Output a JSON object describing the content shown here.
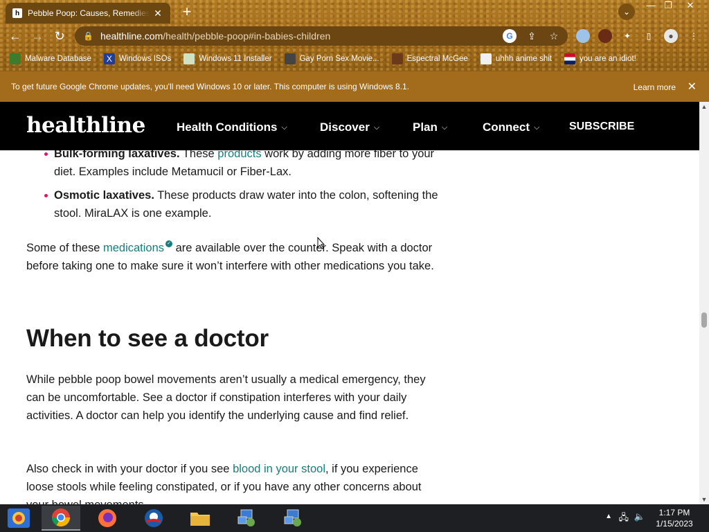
{
  "browser": {
    "tab_title": "Pebble Poop: Causes, Remedies, and More",
    "tab_favicon": "h",
    "url_host": "healthline.com",
    "url_path": "/health/pebble-poop#in-babies-children",
    "bookmarks": [
      {
        "label": "Malware Database",
        "icon": "globe-icon"
      },
      {
        "label": "Windows ISOs",
        "icon": "x-logo-icon"
      },
      {
        "label": "Windows 11 Installer",
        "icon": "image-icon"
      },
      {
        "label": "Gay Porn Sex Movie...",
        "icon": "avatar-icon"
      },
      {
        "label": "Espectral McGee",
        "icon": "avatar-icon"
      },
      {
        "label": "uhhh anime shit",
        "icon": "avatar-icon"
      },
      {
        "label": "you are an idiot!",
        "icon": "flag-icon"
      }
    ]
  },
  "infobar": {
    "message": "To get future Google Chrome updates, you'll need Windows 10 or later. This computer is using Windows 8.1.",
    "learn_more": "Learn more"
  },
  "site": {
    "logo": "healthline",
    "nav": [
      "Health Conditions",
      "Discover",
      "Plan",
      "Connect"
    ],
    "subscribe": "SUBSCRIBE"
  },
  "article": {
    "bullets": [
      {
        "bold": "Bulk-forming laxatives.",
        "pre": " These ",
        "link": "products",
        "post": " work by adding more fiber to your diet. Examples include Metamucil or Fiber-Lax."
      },
      {
        "bold": "Osmotic laxatives.",
        "pre": " These products draw water into the colon, softening the stool. MiraLAX is one example.",
        "link": "",
        "post": ""
      }
    ],
    "para1": {
      "pre": "Some of these ",
      "link": "medications",
      "post": " are available over the counter. Speak with a doctor before taking one to make sure it won’t interfere with other medications you take."
    },
    "heading": "When to see a doctor",
    "para2": "While pebble poop bowel movements aren’t usually a medical emergency, they can be uncomfortable. See a doctor if constipation interferes with your daily activities. A doctor can help you identify the underlying cause and find relief.",
    "para3": {
      "pre": "Also check in with your doctor if you see ",
      "link": "blood in your stool",
      "post": ", if you experience loose stools while feeling constipated, or if you have any other concerns about your bowel movements."
    }
  },
  "taskbar": {
    "time": "1:17 PM",
    "date": "1/15/2023",
    "apps": [
      "windows-start-icon",
      "chrome-icon",
      "firefox-icon",
      "obama-logo-icon",
      "file-explorer-icon",
      "network-app-icon",
      "network-app-icon"
    ]
  },
  "colors": {
    "link": "#197c7c",
    "bullet": "#d6196b",
    "header_bg": "#000000",
    "infobar_bg": "#a36b1c"
  }
}
